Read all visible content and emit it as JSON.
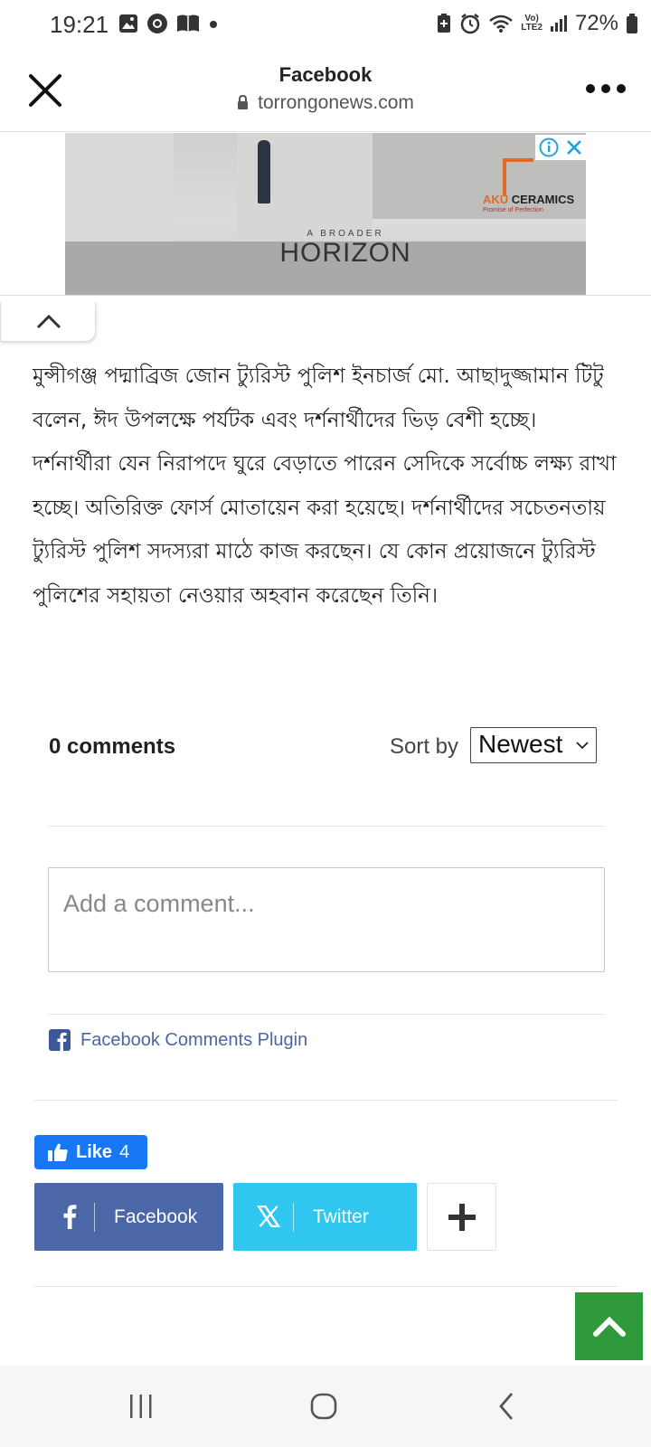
{
  "status_bar": {
    "time": "19:21",
    "battery_percent": "72%",
    "network_label": "LTE2",
    "left_icons": [
      "gallery-icon",
      "chrome-icon",
      "book-icon",
      "dot-icon"
    ],
    "right_icons": [
      "battery-saver-icon",
      "alarm-icon",
      "wifi-icon",
      "signal-icon",
      "battery-icon"
    ]
  },
  "browser": {
    "title": "Facebook",
    "url": "torrongonews.com"
  },
  "ad": {
    "tagline_small": "A BROADER",
    "tagline_main": "HORIZON",
    "brand_prefix": "AKU",
    "brand_name": "CERAMICS",
    "brand_tag": "Promise of Perfection"
  },
  "article": {
    "paragraph": "মুন্সীগঞ্জ পদ্মাব্রিজ জোন ট্যুরিস্ট পুলিশ ইনচার্জ মো. আছাদুজ্জামান টিটু বলেন, ঈদ উপলক্ষে পর্যটক এবং দর্শনার্থীদের ভিড় বেশী হচ্ছে। দর্শনার্থীরা যেন নিরাপদে ঘুরে বেড়াতে পারেন সেদিকে সর্বোচ্চ লক্ষ্য রাখা হচ্ছে। অতিরিক্ত ফোর্স মোতায়েন করা হয়েছে। দর্শনার্থীদের সচেতনতায় ট্যুরিস্ট পুলিশ সদস্যরা মাঠে কাজ করছেন। যে কোন প্রয়োজনে ট্যুরিস্ট পুলিশের সহায়তা নেওয়ার অহবান করেছেন তিনি।"
  },
  "comments": {
    "count_label": "0 comments",
    "sort_label": "Sort by",
    "sort_value": "Newest",
    "input_placeholder": "Add a comment...",
    "plugin_label": "Facebook Comments Plugin"
  },
  "social": {
    "like_label": "Like",
    "like_count": "4",
    "share_facebook": "Facebook",
    "share_twitter": "Twitter"
  },
  "colors": {
    "facebook_blue": "#4b67a8",
    "like_blue": "#1877f2",
    "twitter_cyan": "#2fc6ef",
    "scroll_top_green": "#2e9a3b"
  }
}
